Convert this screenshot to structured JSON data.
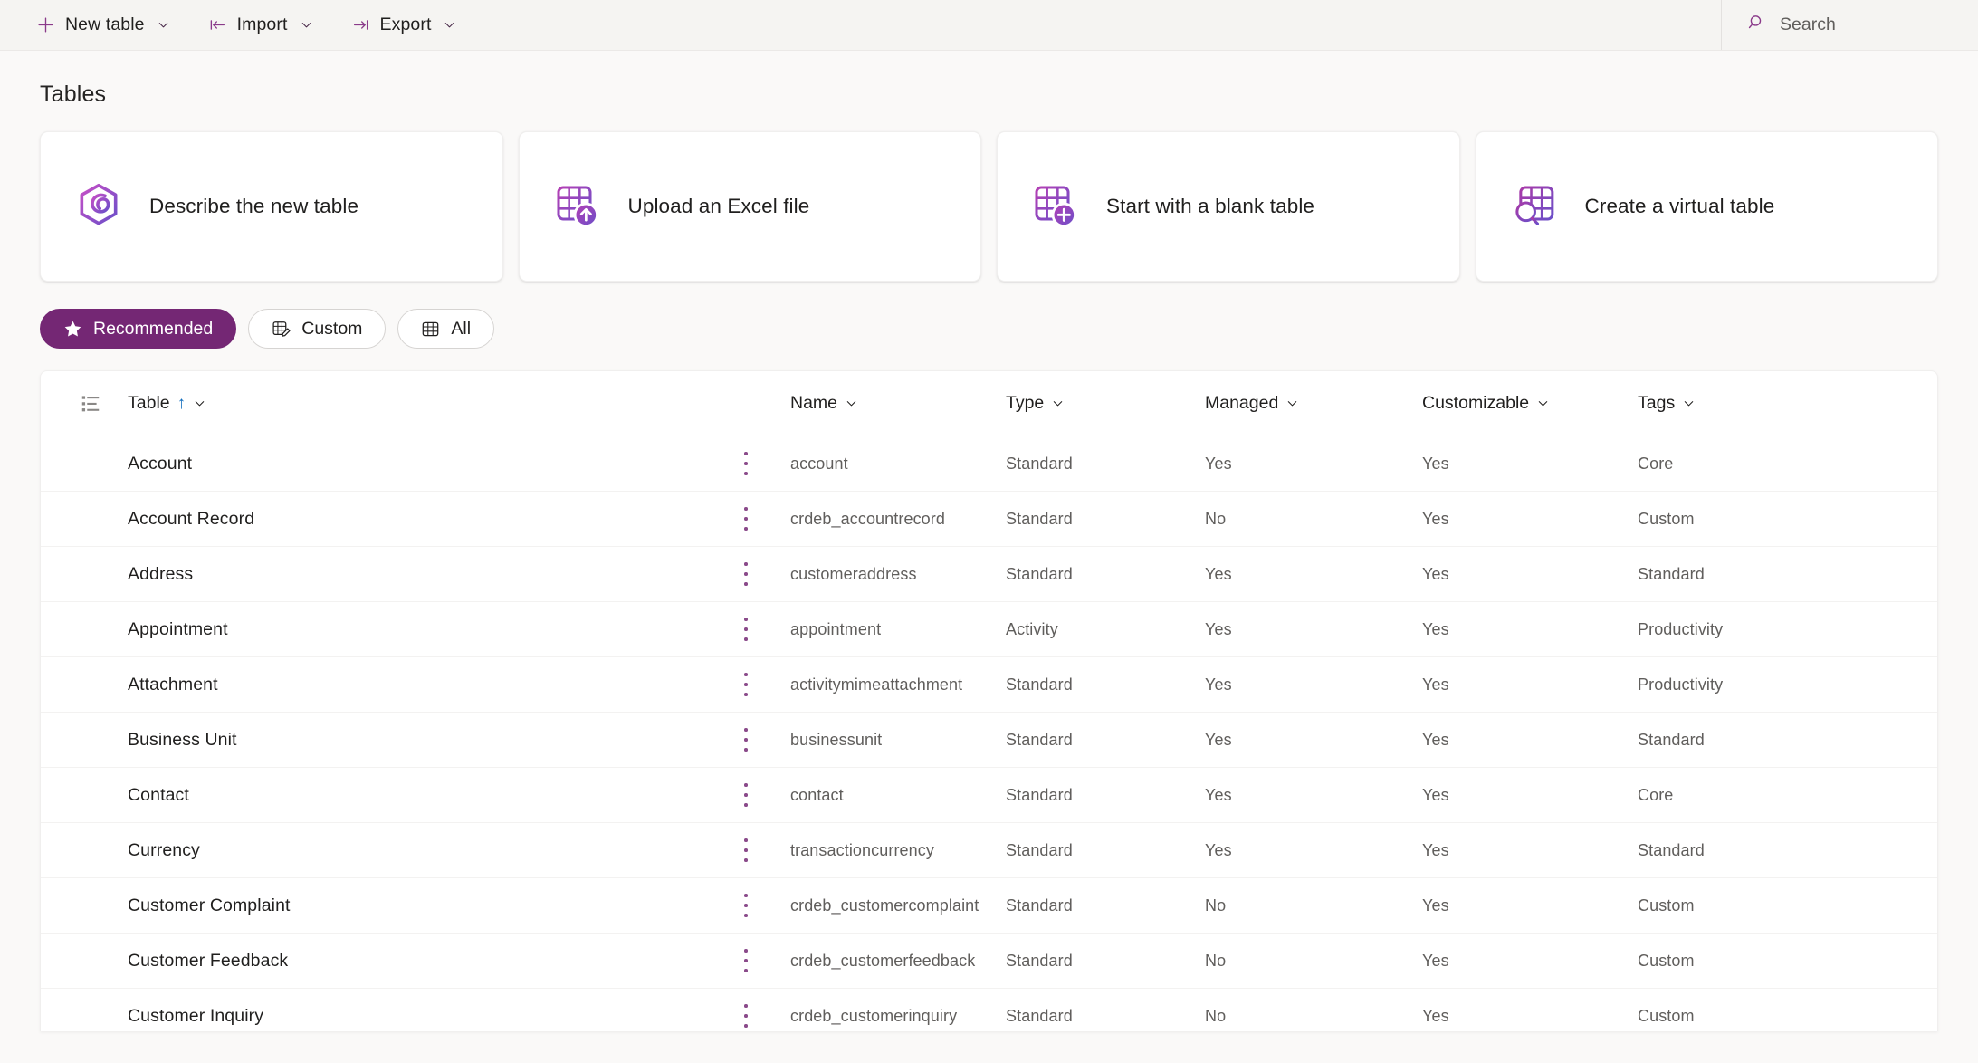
{
  "commandbar": {
    "buttons": [
      {
        "label": "New table",
        "icon": "plus-icon",
        "has_chevron": true
      },
      {
        "label": "Import",
        "icon": "import-arrow-icon",
        "has_chevron": true
      },
      {
        "label": "Export",
        "icon": "export-arrow-icon",
        "has_chevron": true
      }
    ],
    "search": {
      "placeholder": "Search",
      "icon": "search-icon"
    }
  },
  "page": {
    "title": "Tables"
  },
  "cards": [
    {
      "label": "Describe the new table",
      "icon": "copilot-icon"
    },
    {
      "label": "Upload an Excel file",
      "icon": "table-upload-icon"
    },
    {
      "label": "Start with a blank table",
      "icon": "table-add-icon"
    },
    {
      "label": "Create a virtual table",
      "icon": "table-search-icon"
    }
  ],
  "filters": [
    {
      "label": "Recommended",
      "icon": "star-icon",
      "active": true
    },
    {
      "label": "Custom",
      "icon": "table-edit-icon",
      "active": false
    },
    {
      "label": "All",
      "icon": "table-icon",
      "active": false
    }
  ],
  "colors": {
    "accent": "#742774",
    "sort_arrow": "#0f6cbd",
    "icon_purple_start": "#c24fc2",
    "icon_purple_end": "#6b4fc9",
    "page_bg": "#faf9f8",
    "commandbar_bg": "#f5f4f2"
  },
  "grid": {
    "select_icon": "list-view-icon",
    "columns": [
      {
        "key": "table",
        "label": "Table",
        "sorted": true,
        "sort_dir": "↑"
      },
      {
        "key": "name",
        "label": "Name",
        "sorted": false
      },
      {
        "key": "type",
        "label": "Type",
        "sorted": false
      },
      {
        "key": "managed",
        "label": "Managed",
        "sorted": false
      },
      {
        "key": "customizable",
        "label": "Customizable",
        "sorted": false
      },
      {
        "key": "tags",
        "label": "Tags",
        "sorted": false
      }
    ],
    "rows": [
      {
        "table": "Account",
        "name": "account",
        "type": "Standard",
        "managed": "Yes",
        "customizable": "Yes",
        "tags": "Core"
      },
      {
        "table": "Account Record",
        "name": "crdeb_accountrecord",
        "type": "Standard",
        "managed": "No",
        "customizable": "Yes",
        "tags": "Custom"
      },
      {
        "table": "Address",
        "name": "customeraddress",
        "type": "Standard",
        "managed": "Yes",
        "customizable": "Yes",
        "tags": "Standard"
      },
      {
        "table": "Appointment",
        "name": "appointment",
        "type": "Activity",
        "managed": "Yes",
        "customizable": "Yes",
        "tags": "Productivity"
      },
      {
        "table": "Attachment",
        "name": "activitymimeattachment",
        "type": "Standard",
        "managed": "Yes",
        "customizable": "Yes",
        "tags": "Productivity"
      },
      {
        "table": "Business Unit",
        "name": "businessunit",
        "type": "Standard",
        "managed": "Yes",
        "customizable": "Yes",
        "tags": "Standard"
      },
      {
        "table": "Contact",
        "name": "contact",
        "type": "Standard",
        "managed": "Yes",
        "customizable": "Yes",
        "tags": "Core"
      },
      {
        "table": "Currency",
        "name": "transactioncurrency",
        "type": "Standard",
        "managed": "Yes",
        "customizable": "Yes",
        "tags": "Standard"
      },
      {
        "table": "Customer Complaint",
        "name": "crdeb_customercomplaint",
        "type": "Standard",
        "managed": "No",
        "customizable": "Yes",
        "tags": "Custom"
      },
      {
        "table": "Customer Feedback",
        "name": "crdeb_customerfeedback",
        "type": "Standard",
        "managed": "No",
        "customizable": "Yes",
        "tags": "Custom"
      },
      {
        "table": "Customer Inquiry",
        "name": "crdeb_customerinquiry",
        "type": "Standard",
        "managed": "No",
        "customizable": "Yes",
        "tags": "Custom"
      }
    ]
  }
}
